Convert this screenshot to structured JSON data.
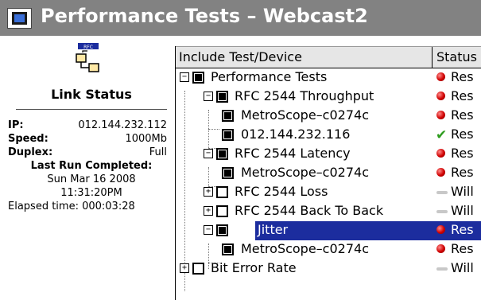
{
  "window": {
    "title": "Performance Tests – Webcast2",
    "icon": "window-icon"
  },
  "link_status": {
    "icon": "link-devices-icon",
    "title": "Link Status",
    "ip_label": "IP:",
    "ip_value": "012.144.232.112",
    "speed_label": "Speed:",
    "speed_value": "1000Mb",
    "duplex_label": "Duplex:",
    "duplex_value": "Full",
    "last_run_label": "Last Run Completed:",
    "last_run_date": "Sun Mar 16 2008",
    "last_run_time": "11:31:20PM",
    "elapsed": "Elapsed time: 000:03:28"
  },
  "grid": {
    "col_test": "Include Test/Device",
    "col_status": "Status",
    "rows": [
      {
        "label": "Performance Tests",
        "status": "Res",
        "status_icon": "red-dot"
      },
      {
        "label": "RFC 2544 Throughput",
        "status": "Res",
        "status_icon": "red-dot"
      },
      {
        "label": "MetroScope–c0274c",
        "status": "Res",
        "status_icon": "red-dot"
      },
      {
        "label": "012.144.232.116",
        "status": "Res",
        "status_icon": "green-check"
      },
      {
        "label": "RFC 2544 Latency",
        "status": "Res",
        "status_icon": "red-dot"
      },
      {
        "label": "MetroScope–c0274c",
        "status": "Res",
        "status_icon": "red-dot"
      },
      {
        "label": "RFC 2544 Loss",
        "status": "Will",
        "status_icon": "gray-dash"
      },
      {
        "label": "RFC 2544 Back To Back",
        "status": "Will",
        "status_icon": "gray-dash"
      },
      {
        "label": "Jitter",
        "status": "Res",
        "status_icon": "red-dot"
      },
      {
        "label": "MetroScope–c0274c",
        "status": "Res",
        "status_icon": "red-dot"
      },
      {
        "label": "Bit Error Rate",
        "status": "Will",
        "status_icon": "gray-dash"
      }
    ]
  },
  "colors": {
    "titlebar": "#828282",
    "selection": "#1c2d9e",
    "error": "#d00000",
    "ok": "#2e9c1e"
  }
}
